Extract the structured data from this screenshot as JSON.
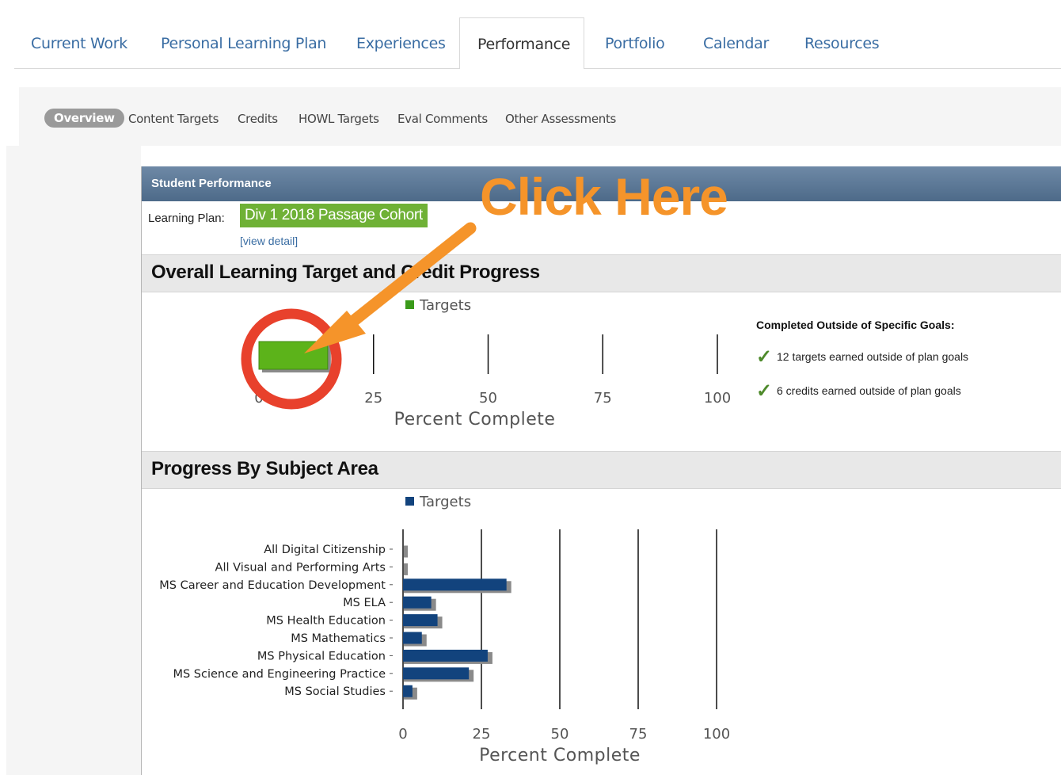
{
  "tabs": [
    {
      "label": "Current Work",
      "active": false
    },
    {
      "label": "Personal Learning Plan",
      "active": false
    },
    {
      "label": "Experiences",
      "active": false
    },
    {
      "label": "Performance",
      "active": true
    },
    {
      "label": "Portfolio",
      "active": false
    },
    {
      "label": "Calendar",
      "active": false
    },
    {
      "label": "Resources",
      "active": false
    }
  ],
  "subtabs": [
    {
      "label": "Overview",
      "active": true
    },
    {
      "label": "Content Targets",
      "active": false
    },
    {
      "label": "Credits",
      "active": false
    },
    {
      "label": "HOWL Targets",
      "active": false
    },
    {
      "label": "Eval Comments",
      "active": false
    },
    {
      "label": "Other Assessments",
      "active": false
    }
  ],
  "panel": {
    "header": "Student Performance",
    "learning_plan_label": "Learning Plan:",
    "learning_plan_value": "Div 1 2018 Passage Cohort",
    "view_detail": "[view detail]"
  },
  "overall_section": {
    "title": "Overall Learning Target and Credit Progress"
  },
  "subject_section": {
    "title": "Progress By Subject Area"
  },
  "completed_outside": {
    "title": "Completed Outside of Specific Goals:",
    "items": [
      "12 targets earned outside of plan goals",
      "6 credits earned outside of plan goals"
    ]
  },
  "annotation": {
    "text": "Click Here",
    "color": "#f5942a",
    "circle_color": "#e8412c"
  },
  "colors": {
    "tab_link": "#3a6da3",
    "overall_bar": "#5cb31a",
    "subject_bar": "#12437d",
    "cohort_bg": "#6fb136"
  },
  "chart_data": [
    {
      "type": "bar",
      "orientation": "horizontal",
      "legend": [
        "Targets"
      ],
      "legend_color": "#3a9a1a",
      "categories": [
        "Targets"
      ],
      "series": [
        {
          "name": "Targets",
          "values": [
            15
          ]
        }
      ],
      "xlabel": "Percent Complete",
      "xlim": [
        0,
        100
      ],
      "xticks": [
        "0",
        "25",
        "50",
        "75",
        "100"
      ],
      "grid": true
    },
    {
      "type": "bar",
      "orientation": "horizontal",
      "legend": [
        "Targets"
      ],
      "legend_color": "#12437d",
      "categories": [
        "All Digital Citizenship",
        "All Visual and Performing Arts",
        "MS Career and Education Development",
        "MS ELA",
        "MS Health Education",
        "MS Mathematics",
        "MS Physical Education",
        "MS Science and Engineering Practice",
        "MS Social Studies"
      ],
      "series": [
        {
          "name": "Targets",
          "values": [
            0,
            0,
            33,
            9,
            11,
            6,
            27,
            21,
            3
          ]
        }
      ],
      "xlabel": "Percent Complete",
      "xlim": [
        0,
        100
      ],
      "xticks": [
        "0",
        "25",
        "50",
        "75",
        "100"
      ],
      "grid": true
    }
  ]
}
